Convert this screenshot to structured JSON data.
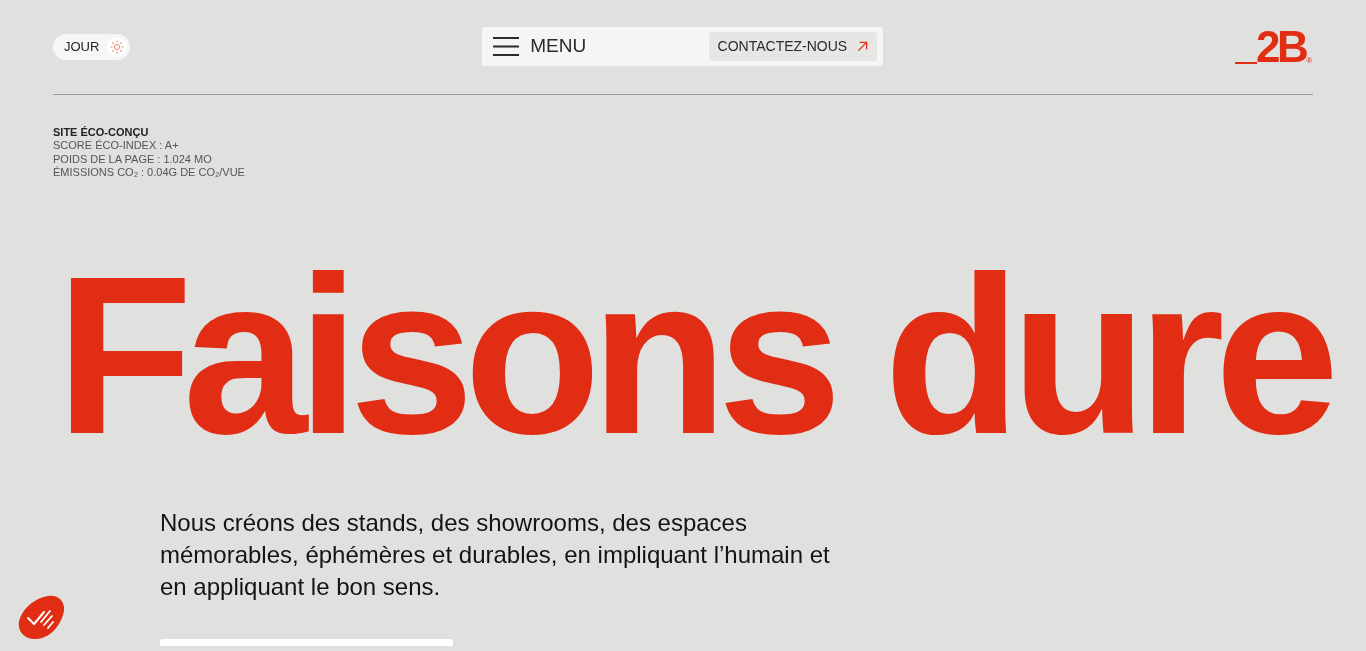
{
  "theme_toggle": {
    "label": "JOUR"
  },
  "menu_bar": {
    "label": "MENU",
    "contact_button": "CONTACTEZ-NOUS"
  },
  "logo": {
    "text": "2B",
    "mark": "®"
  },
  "eco_info": {
    "title": "SITE ÉCO-CONÇU",
    "lines": [
      "SCORE ÉCO-INDEX : A+",
      "POIDS DE LA PAGE : 1.024 MO",
      "ÉMISSIONS CO₂ : 0.04G DE CO₂/VUE"
    ]
  },
  "hero": {
    "headline": "Faisons dure",
    "intro": "Nous créons des stands, des showrooms, des espaces mémorables, éphémères et durables, en impliquant l’humain et en appliquant le bon sens."
  }
}
